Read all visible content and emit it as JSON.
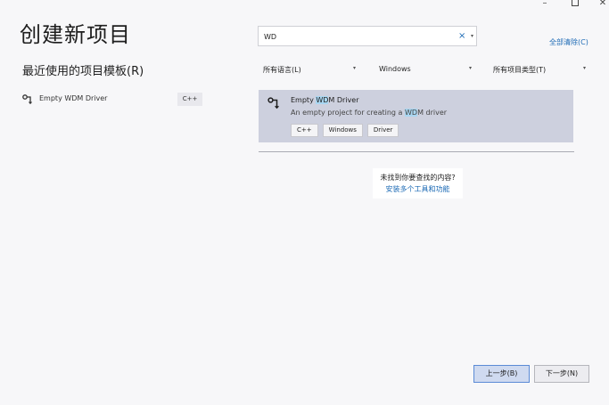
{
  "window": {
    "minimize_glyph": "–",
    "close_glyph": "✕"
  },
  "header": {
    "title": "创建新项目"
  },
  "recent": {
    "title": "最近使用的项目模板(R)",
    "items": [
      {
        "icon": "driver-template-icon",
        "label": "Empty WDM Driver",
        "language": "C++"
      }
    ]
  },
  "search": {
    "value": "WD",
    "placeholder": "",
    "clear_glyph": "×",
    "dropdown_glyph": "▾",
    "clear_all_label": "全部清除(C)"
  },
  "filters": {
    "language": {
      "label": "所有语言(L)",
      "caret": "▾"
    },
    "platform": {
      "label": "Windows",
      "caret": "▾"
    },
    "project_type": {
      "label": "所有项目类型(T)",
      "caret": "▾"
    }
  },
  "results": [
    {
      "name_prefix": "Empty ",
      "name_match": "WD",
      "name_suffix": "M Driver",
      "desc_prefix": "An empty project for creating a ",
      "desc_match": "WD",
      "desc_suffix": "M driver",
      "tags": [
        "C++",
        "Windows",
        "Driver"
      ]
    }
  ],
  "not_found": {
    "question": "未找到你要查找的内容?",
    "link": "安装多个工具和功能"
  },
  "footer": {
    "back_label": "上一步(B)",
    "next_label": "下一步(N)"
  },
  "colors": {
    "accent": "#1c6ab5",
    "selected_card": "#cdd0de",
    "match_highlight": "#a9d6f1",
    "primary_button": "#cfdaf0"
  }
}
